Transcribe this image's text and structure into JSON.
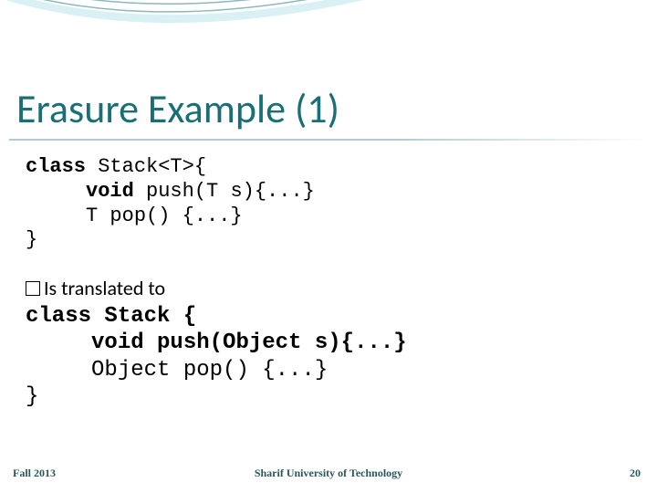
{
  "title": "Erasure Example (1)",
  "code1": {
    "l1_a": "class",
    "l1_b": " Stack<T>{",
    "l2_a": "     void",
    "l2_b": " push(T s){...}",
    "l3": "     T pop() {...}",
    "l4": "}"
  },
  "translated_label": "Is translated to",
  "code2": {
    "l1_a": "class",
    "l1_b": " Stack {",
    "l2_a": "     void",
    "l2_b": " push(Object s){...}",
    "l3": "     Object pop() {...}",
    "l4": "}"
  },
  "footer": {
    "left": "Fall 2013",
    "center": "Sharif University of Technology",
    "right": "20"
  }
}
